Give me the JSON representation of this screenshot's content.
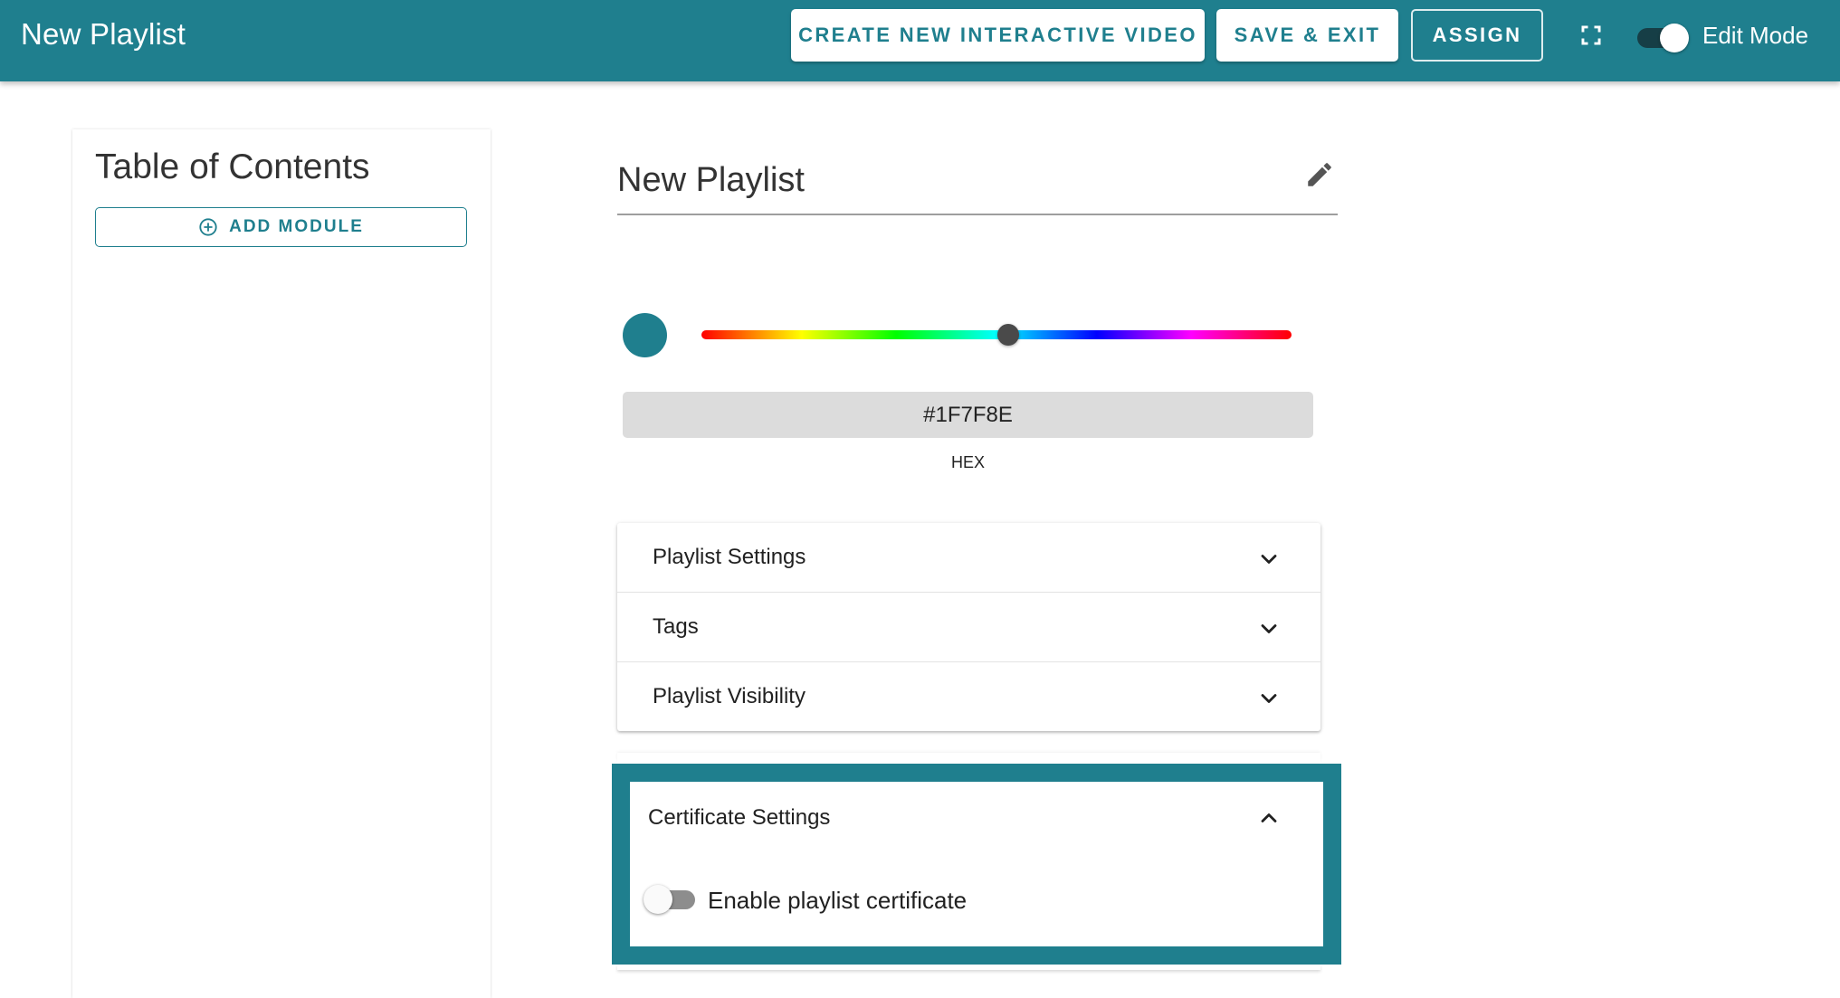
{
  "header": {
    "title": "New Playlist",
    "create_button": "CREATE NEW INTERACTIVE VIDEO",
    "save_button": "SAVE & EXIT",
    "assign_button": "ASSIGN",
    "edit_mode_label": "Edit Mode",
    "edit_mode_on": true
  },
  "toc": {
    "title": "Table of Contents",
    "add_module_label": "ADD MODULE"
  },
  "main": {
    "playlist_name": "New Playlist",
    "color": {
      "hex_value": "#1F7F8E",
      "hex_label": "HEX",
      "swatch_color": "#1f7f8e"
    },
    "sections": [
      {
        "label": "Playlist Settings",
        "expanded": false
      },
      {
        "label": "Tags",
        "expanded": false
      },
      {
        "label": "Playlist Visibility",
        "expanded": false
      }
    ],
    "certificate": {
      "title": "Certificate Settings",
      "expanded": true,
      "toggle_label": "Enable playlist certificate",
      "toggle_on": false
    }
  },
  "theme": {
    "primary": "#1f7f8e"
  }
}
